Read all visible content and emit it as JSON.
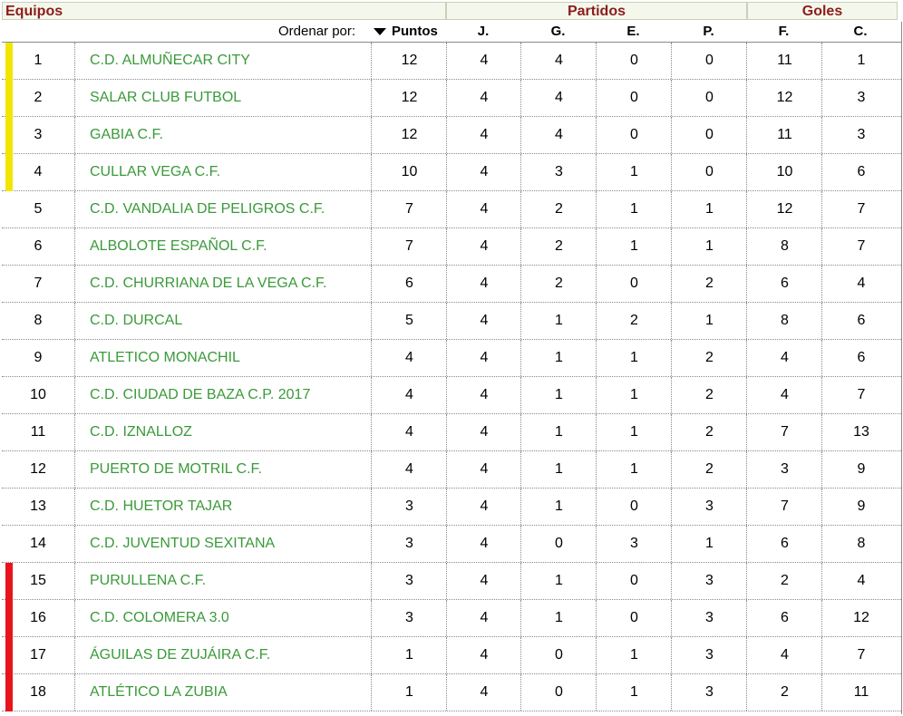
{
  "headers": {
    "equipos": "Equipos",
    "partidos": "Partidos",
    "goles": "Goles"
  },
  "subheaders": {
    "ordenar": "Ordenar por:",
    "puntos": "Puntos",
    "j": "J.",
    "g": "G.",
    "e": "E.",
    "p": "P.",
    "f": "F.",
    "c": "C."
  },
  "colors": {
    "promotion": "#f2e600",
    "relegation": "#e8141c",
    "team": "#3a9a3a",
    "header": "#8c1c1c"
  },
  "rows": [
    {
      "pos": "1",
      "team": "C.D. ALMUÑECAR CITY",
      "pts": "12",
      "j": "4",
      "g": "4",
      "e": "0",
      "p": "0",
      "f": "11",
      "c": "1",
      "zone": "promotion"
    },
    {
      "pos": "2",
      "team": "SALAR CLUB FUTBOL",
      "pts": "12",
      "j": "4",
      "g": "4",
      "e": "0",
      "p": "0",
      "f": "12",
      "c": "3",
      "zone": "promotion"
    },
    {
      "pos": "3",
      "team": "GABIA C.F.",
      "pts": "12",
      "j": "4",
      "g": "4",
      "e": "0",
      "p": "0",
      "f": "11",
      "c": "3",
      "zone": "promotion"
    },
    {
      "pos": "4",
      "team": "CULLAR VEGA C.F.",
      "pts": "10",
      "j": "4",
      "g": "3",
      "e": "1",
      "p": "0",
      "f": "10",
      "c": "6",
      "zone": "promotion"
    },
    {
      "pos": "5",
      "team": "C.D. VANDALIA DE PELIGROS C.F.",
      "pts": "7",
      "j": "4",
      "g": "2",
      "e": "1",
      "p": "1",
      "f": "12",
      "c": "7",
      "zone": ""
    },
    {
      "pos": "6",
      "team": "ALBOLOTE ESPAÑOL C.F.",
      "pts": "7",
      "j": "4",
      "g": "2",
      "e": "1",
      "p": "1",
      "f": "8",
      "c": "7",
      "zone": ""
    },
    {
      "pos": "7",
      "team": "C.D. CHURRIANA DE LA VEGA C.F.",
      "pts": "6",
      "j": "4",
      "g": "2",
      "e": "0",
      "p": "2",
      "f": "6",
      "c": "4",
      "zone": ""
    },
    {
      "pos": "8",
      "team": "C.D. DURCAL",
      "pts": "5",
      "j": "4",
      "g": "1",
      "e": "2",
      "p": "1",
      "f": "8",
      "c": "6",
      "zone": ""
    },
    {
      "pos": "9",
      "team": "ATLETICO MONACHIL",
      "pts": "4",
      "j": "4",
      "g": "1",
      "e": "1",
      "p": "2",
      "f": "4",
      "c": "6",
      "zone": ""
    },
    {
      "pos": "10",
      "team": "C.D. CIUDAD DE BAZA C.P. 2017",
      "pts": "4",
      "j": "4",
      "g": "1",
      "e": "1",
      "p": "2",
      "f": "4",
      "c": "7",
      "zone": ""
    },
    {
      "pos": "11",
      "team": "C.D. IZNALLOZ",
      "pts": "4",
      "j": "4",
      "g": "1",
      "e": "1",
      "p": "2",
      "f": "7",
      "c": "13",
      "zone": ""
    },
    {
      "pos": "12",
      "team": "PUERTO DE MOTRIL C.F.",
      "pts": "4",
      "j": "4",
      "g": "1",
      "e": "1",
      "p": "2",
      "f": "3",
      "c": "9",
      "zone": ""
    },
    {
      "pos": "13",
      "team": "C.D. HUETOR TAJAR",
      "pts": "3",
      "j": "4",
      "g": "1",
      "e": "0",
      "p": "3",
      "f": "7",
      "c": "9",
      "zone": ""
    },
    {
      "pos": "14",
      "team": "C.D. JUVENTUD SEXITANA",
      "pts": "3",
      "j": "4",
      "g": "0",
      "e": "3",
      "p": "1",
      "f": "6",
      "c": "8",
      "zone": ""
    },
    {
      "pos": "15",
      "team": "PURULLENA C.F.",
      "pts": "3",
      "j": "4",
      "g": "1",
      "e": "0",
      "p": "3",
      "f": "2",
      "c": "4",
      "zone": "relegation"
    },
    {
      "pos": "16",
      "team": "C.D. COLOMERA 3.0",
      "pts": "3",
      "j": "4",
      "g": "1",
      "e": "0",
      "p": "3",
      "f": "6",
      "c": "12",
      "zone": "relegation"
    },
    {
      "pos": "17",
      "team": "ÁGUILAS DE ZUJÁIRA C.F.",
      "pts": "1",
      "j": "4",
      "g": "0",
      "e": "1",
      "p": "3",
      "f": "4",
      "c": "7",
      "zone": "relegation"
    },
    {
      "pos": "18",
      "team": "ATLÉTICO LA ZUBIA",
      "pts": "1",
      "j": "4",
      "g": "0",
      "e": "1",
      "p": "3",
      "f": "2",
      "c": "11",
      "zone": "relegation"
    }
  ]
}
